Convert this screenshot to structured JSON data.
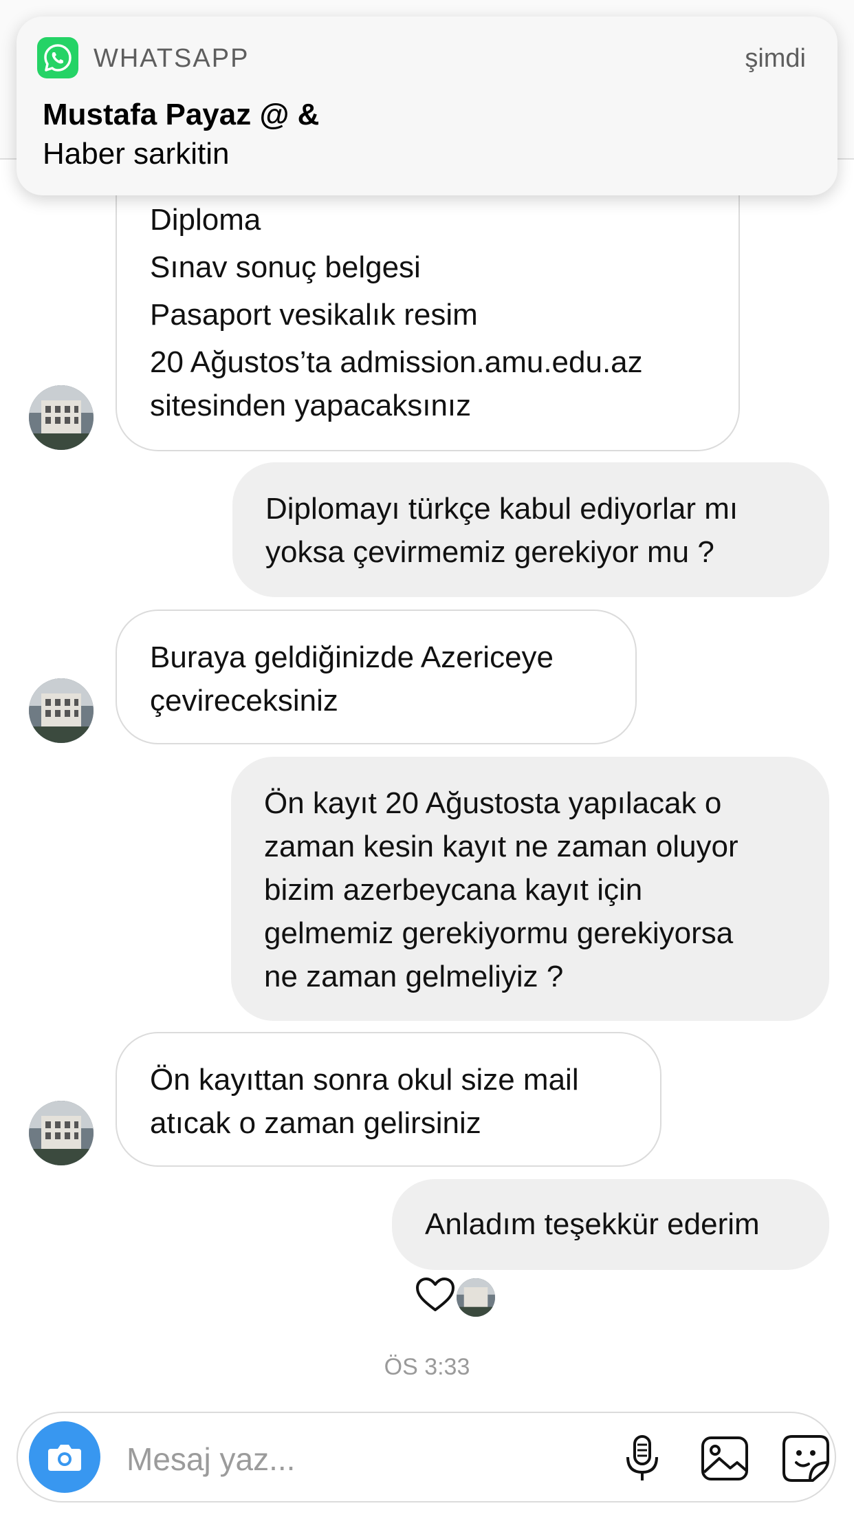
{
  "notification": {
    "app_name": "WHATSAPP",
    "time": "şimdi",
    "title": "Mustafa Payaz @ &",
    "body": "Haber sarkitin"
  },
  "messages": [
    {
      "direction": "incoming",
      "lines": [
        "Diploma",
        "Sınav sonuç belgesi",
        "Pasaport vesikalık resim",
        "20 Ağustos’ta admission.amu.edu.az",
        "sitesinden yapacaksınız"
      ]
    },
    {
      "direction": "outgoing",
      "lines": [
        "Diplomayı türkçe kabul ediyorlar mı",
        "yoksa çevirmemiz gerekiyor mu ?"
      ]
    },
    {
      "direction": "incoming",
      "lines": [
        "Buraya geldiğinizde Azericeye",
        "çevireceksiniz"
      ]
    },
    {
      "direction": "outgoing",
      "lines": [
        "Ön kayıt 20 Ağustosta yapılacak o",
        "zaman kesin kayıt ne zaman oluyor",
        "bizim azerbeycana kayıt için",
        "gelmemiz gerekiyormu gerekiyorsa",
        "ne zaman gelmeliyiz ?"
      ]
    },
    {
      "direction": "incoming",
      "lines": [
        "Ön kayıttan sonra okul size mail",
        "atıcak o zaman gelirsiniz"
      ]
    },
    {
      "direction": "outgoing",
      "lines": [
        "Anladım teşekkür ederim"
      ]
    }
  ],
  "timestamp": "ÖS 3:33",
  "composer": {
    "placeholder": "Mesaj yaz...",
    "icons": [
      "camera-icon",
      "microphone-icon",
      "gallery-icon",
      "sticker-icon"
    ]
  },
  "colors": {
    "accent": "#3897f0",
    "whatsapp": "#25d366",
    "incoming_bg": "#ffffff",
    "outgoing_bg": "#efefef"
  }
}
